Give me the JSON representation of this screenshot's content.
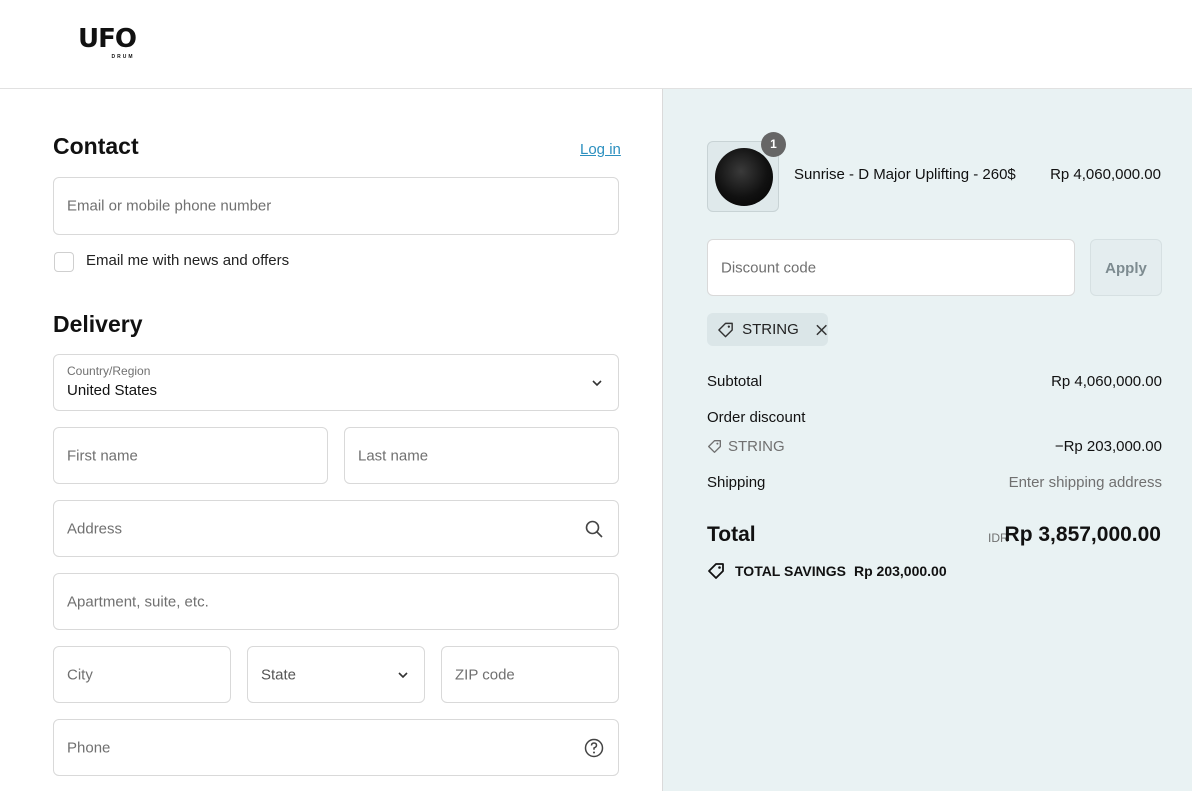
{
  "header": {
    "logo_text": "UFO",
    "logo_subtext": "DRUM"
  },
  "contact": {
    "title": "Contact",
    "login_link": "Log in",
    "email_placeholder": "Email or mobile phone number",
    "newsletter_label": "Email me with news and offers",
    "newsletter_checked": false
  },
  "delivery": {
    "title": "Delivery",
    "country_label": "Country/Region",
    "country_value": "United States",
    "first_name_placeholder": "First name",
    "last_name_placeholder": "Last name",
    "address_placeholder": "Address",
    "apartment_placeholder": "Apartment, suite, etc.",
    "city_placeholder": "City",
    "state_placeholder": "State",
    "zip_placeholder": "ZIP code",
    "phone_placeholder": "Phone"
  },
  "summary": {
    "item": {
      "quantity": "1",
      "name": "Sunrise - D Major Uplifting - 260$",
      "price": "Rp 4,060,000.00"
    },
    "discount_placeholder": "Discount code",
    "apply_label": "Apply",
    "applied_code": "STRING",
    "subtotal_label": "Subtotal",
    "subtotal_value": "Rp 4,060,000.00",
    "order_discount_label": "Order discount",
    "discount_code": "STRING",
    "discount_value": "−Rp 203,000.00",
    "shipping_label": "Shipping",
    "shipping_value": "Enter shipping address",
    "total_label": "Total",
    "total_currency": "IDR",
    "total_value": "Rp 3,857,000.00",
    "savings_label": "TOTAL SAVINGS",
    "savings_value": "Rp 203,000.00"
  },
  "colors": {
    "link": "#2b8fbf",
    "summary_bg": "#e9f2f3",
    "border": "#d9d9d9"
  }
}
